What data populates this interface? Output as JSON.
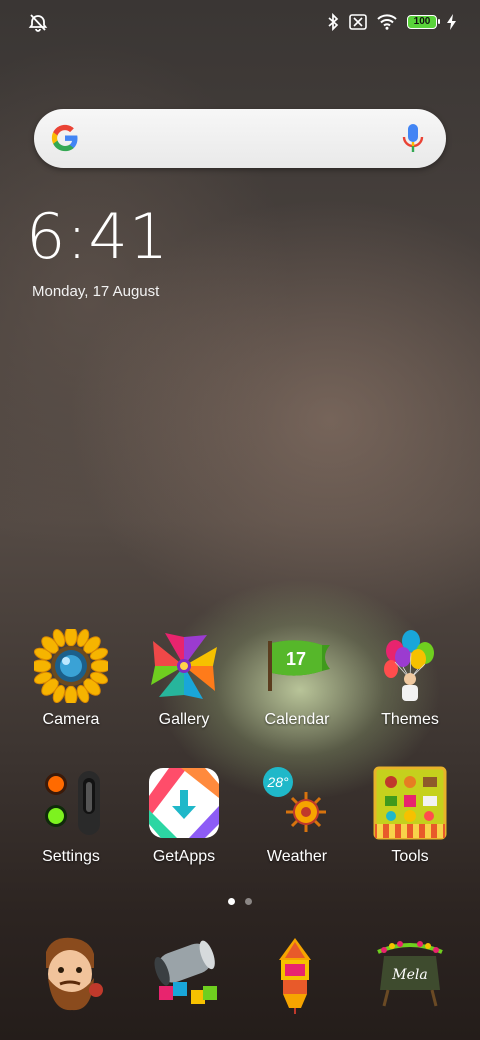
{
  "status_bar": {
    "battery_level": "100"
  },
  "clock": {
    "time": "6:41",
    "date": "Monday, 17 August"
  },
  "apps_row1": [
    {
      "label": "Camera"
    },
    {
      "label": "Gallery"
    },
    {
      "label": "Calendar",
      "day": "17"
    },
    {
      "label": "Themes"
    }
  ],
  "apps_row2": [
    {
      "label": "Settings"
    },
    {
      "label": "GetApps"
    },
    {
      "label": "Weather",
      "temp": "28°"
    },
    {
      "label": "Tools"
    }
  ],
  "dock_icons": [
    {
      "icon": "contacts-icon"
    },
    {
      "icon": "messages-icon"
    },
    {
      "icon": "browser-icon"
    },
    {
      "icon": "notes-icon",
      "sign_text": "Mela"
    }
  ],
  "page_indicator": {
    "pages": 2,
    "current": 1
  },
  "colors": {
    "battery": "#59d33a",
    "search_bg": "#f0f0f0",
    "calendar_green": "#3f9a1c"
  }
}
